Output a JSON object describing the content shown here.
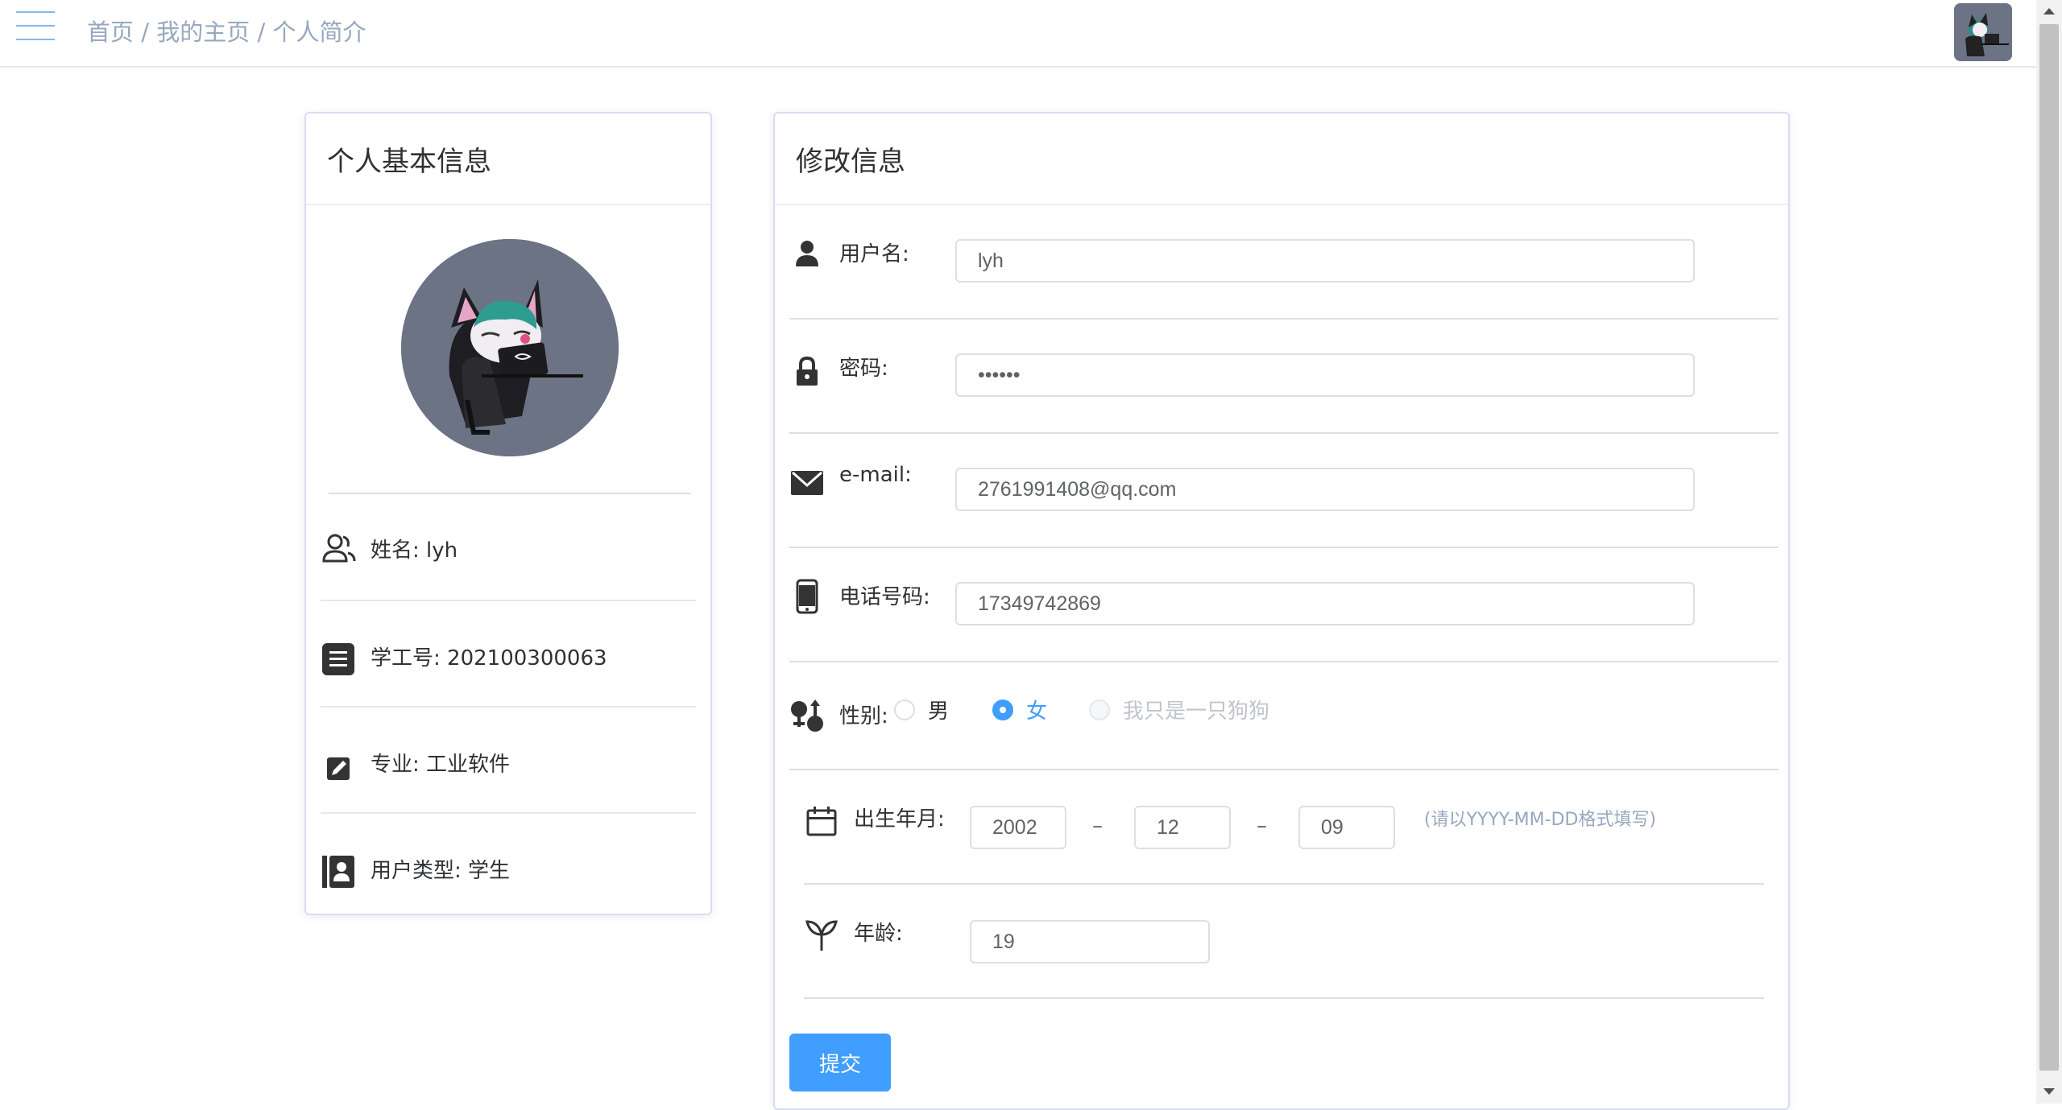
{
  "breadcrumb": {
    "home": "首页",
    "separator1": " / ",
    "my_home": "我的主页",
    "separator2": " / ",
    "profile": "个人简介"
  },
  "left_card": {
    "title": "个人基本信息",
    "items": [
      {
        "label": "姓名: lyh",
        "icon": "user-group-icon"
      },
      {
        "label": "学工号: 202100300063",
        "icon": "document-icon"
      },
      {
        "label": "专业: 工业软件",
        "icon": "edit-icon"
      },
      {
        "label": "用户类型: 学生",
        "icon": "contact-card-icon"
      }
    ]
  },
  "right_card": {
    "title": "修改信息",
    "username": {
      "label": "用户名:",
      "value": "lyh"
    },
    "password": {
      "label": "密码:",
      "value": "••••••"
    },
    "email": {
      "label": "e-mail:",
      "value": "2761991408@qq.com"
    },
    "phone": {
      "label": "电话号码:",
      "value": "17349742869"
    },
    "gender": {
      "label": "性别:",
      "options": [
        "男",
        "女",
        "我只是一只狗狗"
      ],
      "selected": "女"
    },
    "birth": {
      "label": "出生年月:",
      "year": "2002",
      "month": "12",
      "day": "09",
      "dash": "–",
      "hint": "(请以YYYY-MM-DD格式填写)"
    },
    "age": {
      "label": "年龄:",
      "value": "19"
    },
    "submit_label": "提交"
  },
  "colors": {
    "primary": "#409eff",
    "breadcrumb": "#97a8be",
    "avatar_bg": "#6b7385"
  }
}
